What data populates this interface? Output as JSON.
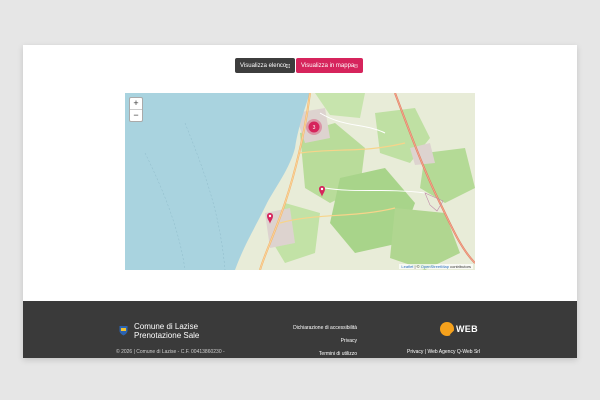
{
  "view_buttons": {
    "list_label": "Visualizza elenco",
    "list_icon": "grid-icon",
    "map_label": "Visualizza in mappa",
    "map_icon": "map-icon"
  },
  "map": {
    "zoom_in": "+",
    "zoom_out": "−",
    "cluster_count": "3",
    "attribution_leaflet": "Leaflet",
    "attribution_sep": " | © ",
    "attribution_osm": "OpenStreetMap",
    "attribution_tail": " contributors"
  },
  "footer": {
    "brand_line1": "Comune di Lazise",
    "brand_line2": "Prenotazione Sale",
    "copyright": "© 2026 | Comune di Lazise - C.F. 00413860230 -",
    "links": [
      "Dichiarazione di accessibilità",
      "Privacy",
      "Termini di utilizzo"
    ],
    "partner_logo": "QWEB",
    "partner_line": "Privacy | Web Agency Q-Web Srl"
  },
  "colors": {
    "accent": "#d6245c",
    "dark_button": "#3d3d3d",
    "footer_bg": "#3a3a3a",
    "lake": "#a9d3df",
    "qweb_orange": "#f5a11c"
  }
}
